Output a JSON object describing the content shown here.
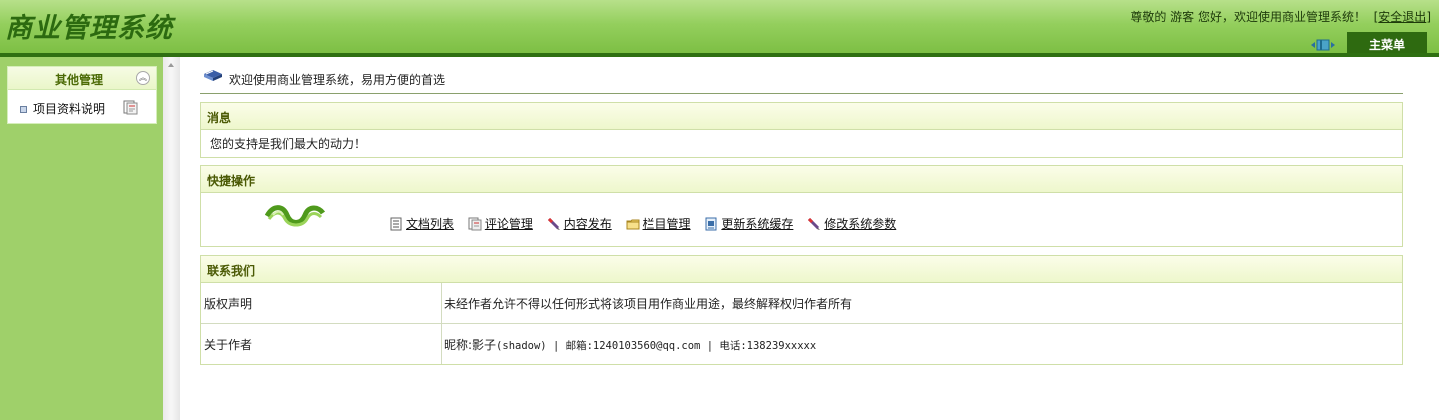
{
  "header": {
    "title": "商业管理系统",
    "welcome_text": "尊敬的 游客 您好，欢迎使用商业管理系统！",
    "logout_open": "[",
    "logout_label": "安全退出",
    "logout_close": "]",
    "main_menu_label": "主菜单"
  },
  "sidebar": {
    "panel_title": "其他管理",
    "collapse_glyph": "︽",
    "items": [
      {
        "label": "项目资料说明",
        "icon": "edit-doc-icon"
      }
    ]
  },
  "main": {
    "intro_text": "欢迎使用商业管理系统，易用方便的首选",
    "message": {
      "title": "消息",
      "body": "您的支持是我们最大的动力！"
    },
    "quick_actions": {
      "title": "快捷操作",
      "links": [
        {
          "label": "文档列表",
          "icon": "document-list-icon"
        },
        {
          "label": "评论管理",
          "icon": "comment-edit-icon"
        },
        {
          "label": "内容发布",
          "icon": "publish-pen-icon"
        },
        {
          "label": "栏目管理",
          "icon": "folder-icon"
        },
        {
          "label": "更新系统缓存",
          "icon": "cache-refresh-icon"
        },
        {
          "label": "修改系统参数",
          "icon": "settings-pen-icon"
        }
      ]
    },
    "contact": {
      "title": "联系我们",
      "rows": [
        {
          "key": "版权声明",
          "value": "未经作者允许不得以任何形式将该项目用作商业用途，最终解释权归作者所有"
        },
        {
          "key": "关于作者",
          "value_prefix": "昵称:影子",
          "value_rest": "(shadow) | 邮箱:1240103560@qq.com | 电话:138239xxxxx"
        }
      ]
    }
  },
  "colors": {
    "header_green": "#94cf5d",
    "dark_green": "#2e6a10",
    "sidebar_green": "#9fd06a",
    "panel_header": "#eef7cc",
    "border": "#cfdfa8"
  }
}
